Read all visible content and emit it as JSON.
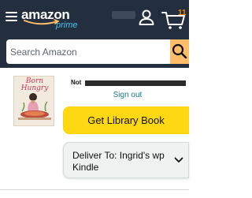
{
  "header": {
    "menu_icon": "hamburger-menu-icon",
    "logo_text": "amazon",
    "logo_sub": "prime",
    "account_icon": "person-icon",
    "cart_icon": "cart-icon",
    "cart_count": "11",
    "colors": {
      "background": "#232f3e",
      "accent": "#febd69",
      "prime_blue": "#48c3f0"
    }
  },
  "search": {
    "placeholder": "Search Amazon",
    "value": "",
    "button_icon": "search-icon"
  },
  "book": {
    "cover_title": "Born Hungry"
  },
  "account_notice": {
    "prefix": "Not",
    "signout_label": "Sign out"
  },
  "library": {
    "button_label": "Get Library Book",
    "colors": {
      "button": "#ffd814"
    }
  },
  "delivery": {
    "label": "Deliver To:  Ingrid's wp Kindle",
    "dropdown_icon": "chevron-down-icon"
  }
}
